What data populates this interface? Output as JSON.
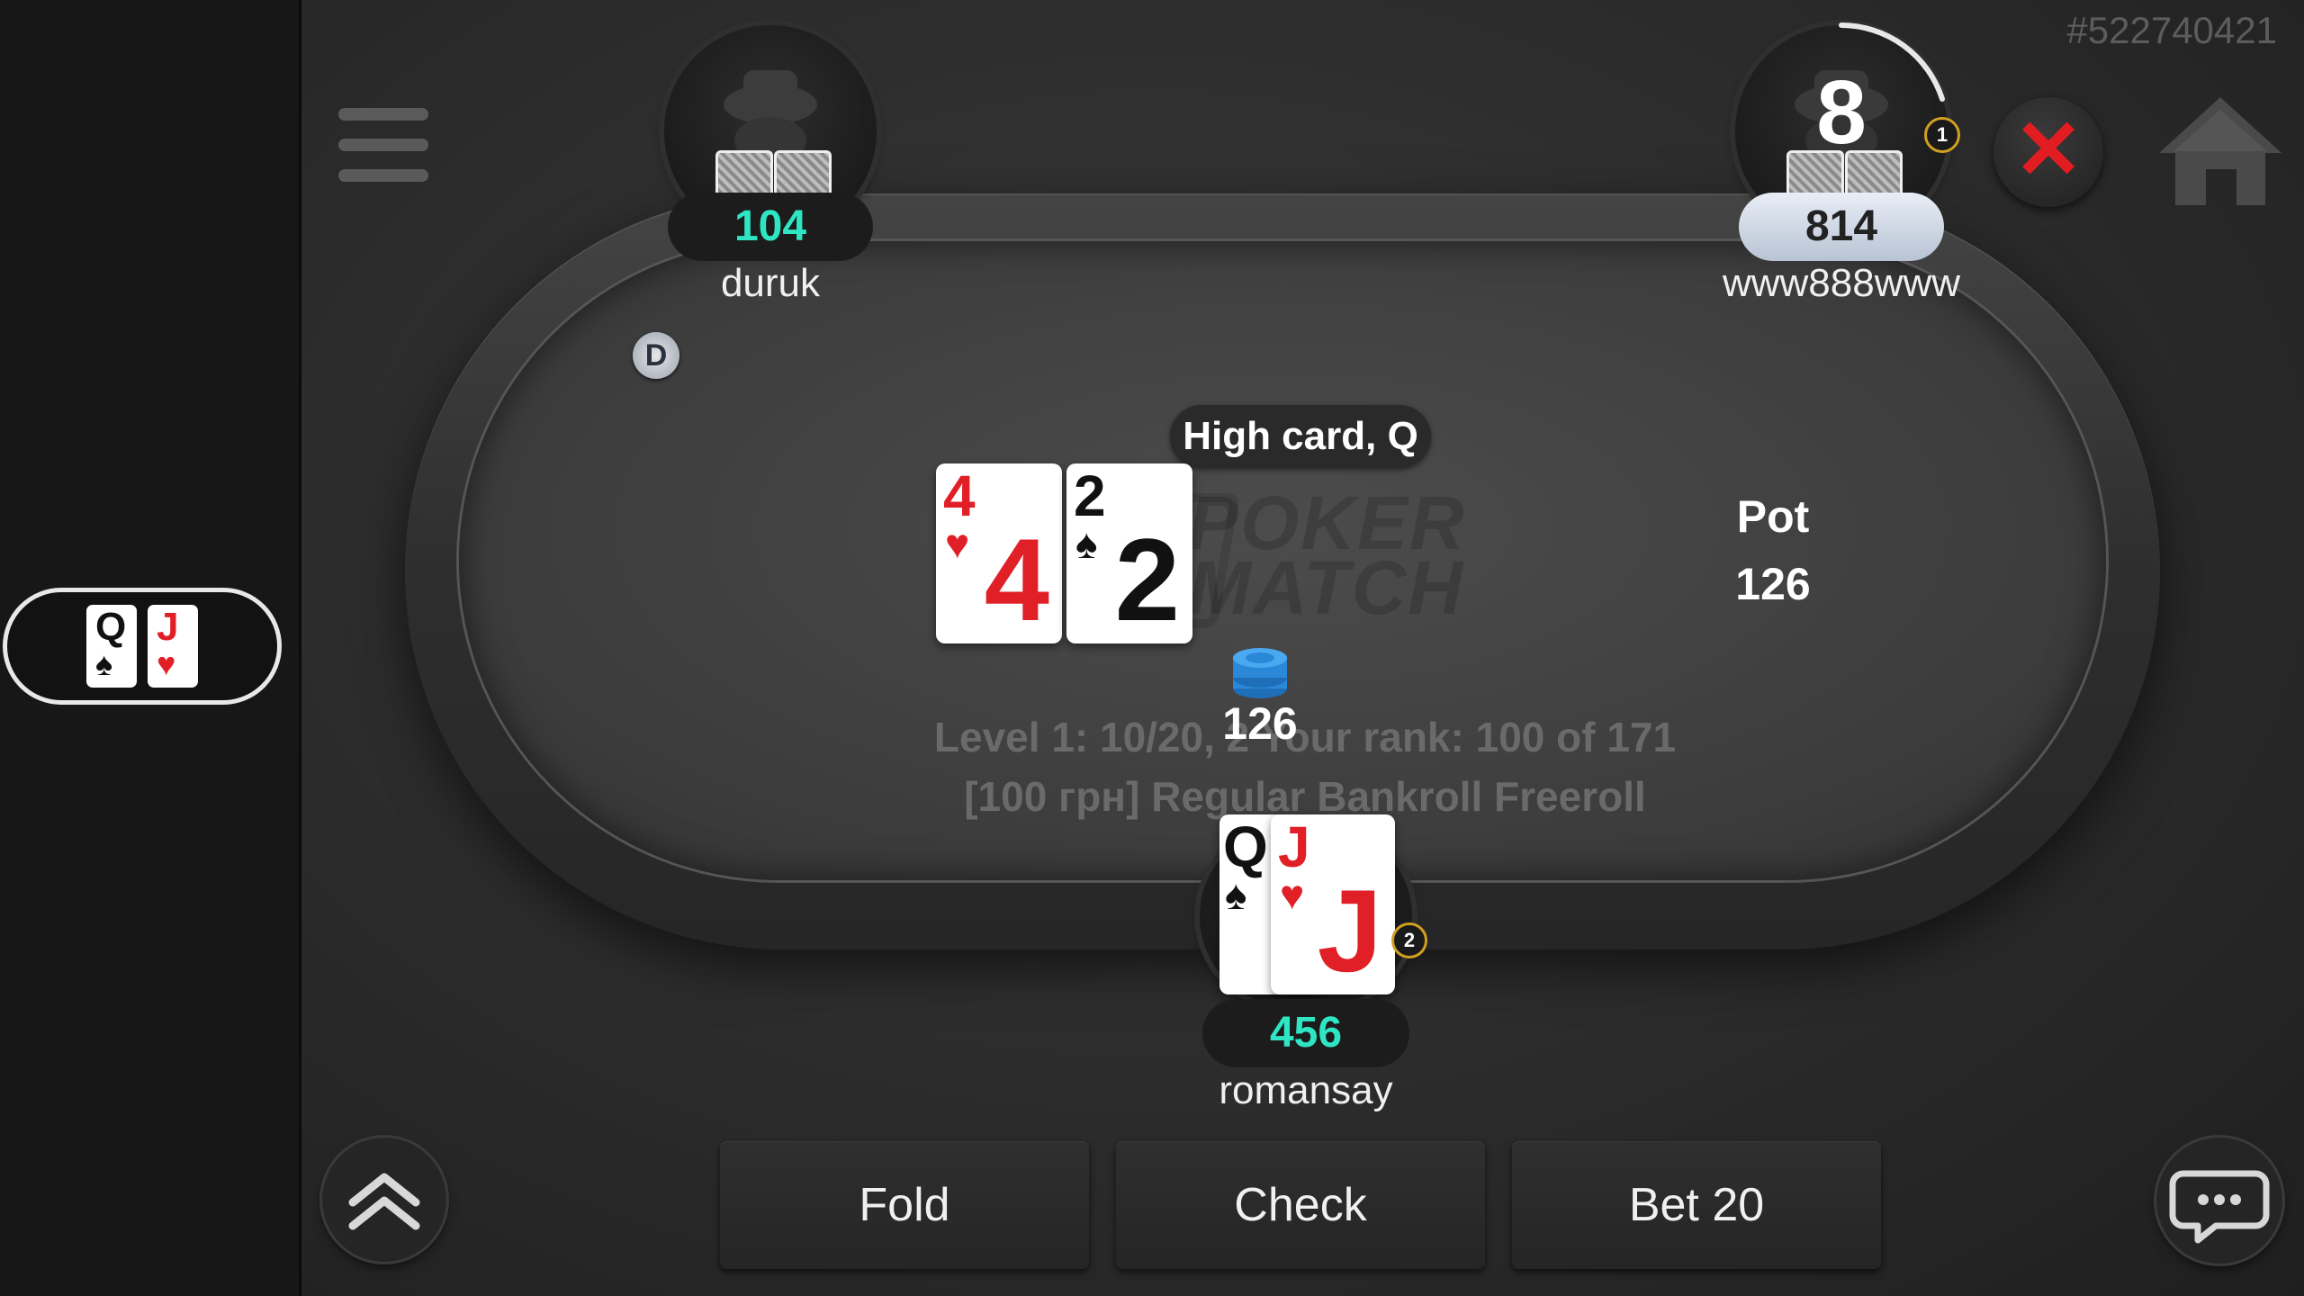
{
  "table_id": "#522740421",
  "hand_strength": "High card, Q",
  "pot": {
    "title": "Pot",
    "value": "126"
  },
  "bet_in_front": "126",
  "info": {
    "line1": "Level 1: 10/20, 2  Your rank: 100 of 171",
    "line2": "[100 грн] Regular Bankroll Freeroll"
  },
  "board": [
    {
      "rank": "4",
      "suit": "♥",
      "color": "#e01f26"
    },
    {
      "rank": "2",
      "suit": "♠",
      "color": "#111111"
    }
  ],
  "logo": {
    "line1": "POKER",
    "line2": "MATCH"
  },
  "players": {
    "top_left": {
      "name": "duruk",
      "stack": "104",
      "stack_color": "#2ee6c4"
    },
    "top_right": {
      "name": "www888www",
      "stack": "814",
      "timer": "8",
      "badge": "1"
    },
    "hero": {
      "name": "romansay",
      "stack": "456",
      "stack_color": "#2ee6c4",
      "badge": "2",
      "cards": [
        {
          "rank": "Q",
          "suit": "♠",
          "color": "#111111"
        },
        {
          "rank": "J",
          "suit": "♥",
          "color": "#e01f26"
        }
      ]
    }
  },
  "dealer_button": "D",
  "mini_table_cards": [
    {
      "rank": "Q",
      "suit": "♠"
    },
    {
      "rank": "J",
      "suit": "♥"
    }
  ],
  "actions": {
    "fold": "Fold",
    "check": "Check",
    "bet": "Bet 20"
  },
  "icons": {
    "close": "close-icon",
    "home": "home-icon",
    "menu": "hamburger-menu-icon",
    "up": "double-chevron-up-icon",
    "chat": "chat-bubble-icon"
  }
}
